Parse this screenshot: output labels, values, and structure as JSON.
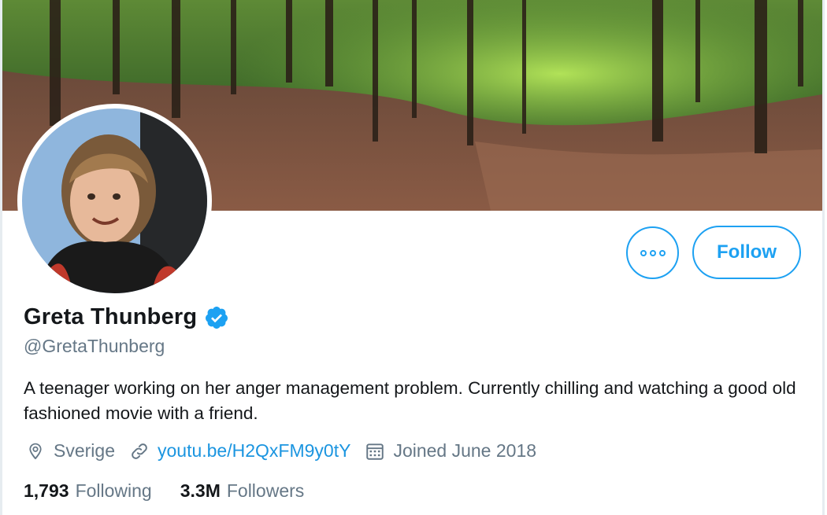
{
  "profile": {
    "name": "Greta Thunberg",
    "handle": "@GretaThunberg",
    "bio": "A teenager working on her anger management problem. Currently chilling and watching a good old fashioned movie with a friend.",
    "location": "Sverige",
    "website": "youtu.be/H2QxFM9y0tY",
    "joined": "Joined June 2018"
  },
  "actions": {
    "follow_label": "Follow"
  },
  "stats": {
    "following_count": "1,793",
    "following_label": "Following",
    "followers_count": "3.3M",
    "followers_label": "Followers"
  },
  "colors": {
    "accent": "#1da1f2",
    "link": "#1b95e0",
    "secondary_text": "#657786",
    "primary_text": "#14171a"
  },
  "icons": {
    "more": "more-dots-icon",
    "verified": "verified-badge-icon",
    "location": "location-pin-icon",
    "link": "link-icon",
    "calendar": "calendar-icon"
  }
}
